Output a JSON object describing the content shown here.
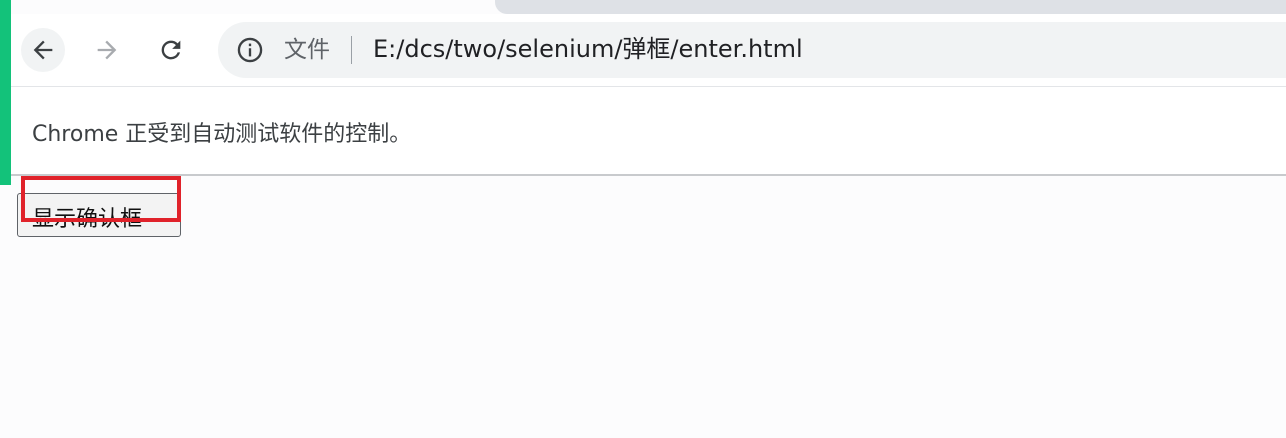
{
  "browser": {
    "back_icon": "arrow-left-icon",
    "forward_icon": "arrow-right-icon",
    "reload_icon": "reload-icon",
    "info_icon": "info-circle-icon",
    "address": {
      "scheme_label": "文件",
      "url": "E:/dcs/two/selenium/弹框/enter.html"
    }
  },
  "infobar": {
    "message": "Chrome 正受到自动测试软件的控制。"
  },
  "page": {
    "confirm_button_label": "显示确认框"
  },
  "colors": {
    "accent_green": "#13c27a",
    "highlight_red": "#e0222a",
    "omnibox_bg": "#f1f3f4"
  }
}
